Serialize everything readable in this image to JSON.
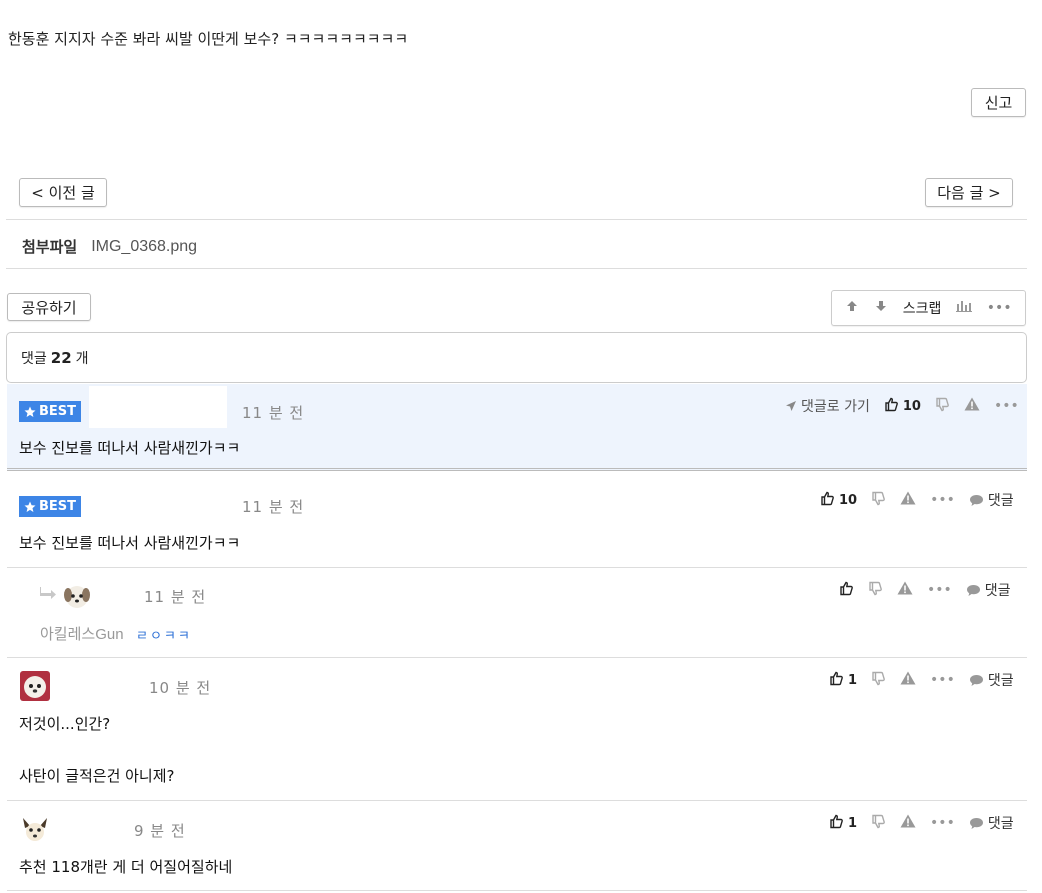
{
  "post": {
    "body": "한동훈 지지자 수준 봐라 씨발 이딴게 보수? ㅋㅋㅋㅋㅋㅋㅋㅋㅋ",
    "report_label": "신고",
    "prev_label": "< 이전 글",
    "next_label": "다음 글 >"
  },
  "attachment": {
    "label": "첨부파일",
    "filename": "IMG_0368.png"
  },
  "share_label": "공유하기",
  "toolbar": {
    "up_icon": "arrow-up-icon",
    "down_icon": "arrow-down-icon",
    "scrap_label": "스크랩",
    "stats_icon": "bar-chart-icon",
    "more_icon": "more-icon"
  },
  "comments_header": {
    "prefix": "댓글",
    "count": "22",
    "suffix": "개"
  },
  "best_pinned": {
    "badge": "BEST",
    "time": "11 분 전",
    "goto_label": "댓글로 가기",
    "likes": "10",
    "text": "보수 진보를 떠나서 사람새낀가ㅋㅋ"
  },
  "comments": [
    {
      "badge": "BEST",
      "time": "11 분 전",
      "likes": "10",
      "reply_label": "댓글",
      "text": "보수 진보를 떠나서 사람새낀가ㅋㅋ"
    },
    {
      "time": "11 분 전",
      "likes": "",
      "reply_label": "댓글",
      "reply_to": "아킬레스Gun",
      "text": "ㄹㅇㅋㅋ"
    },
    {
      "time": "10 분 전",
      "likes": "1",
      "reply_label": "댓글",
      "text_line1": "저것이...인간?",
      "text_line2": "사탄이 글적은건 아니제?"
    },
    {
      "time": "9 분 전",
      "likes": "1",
      "reply_label": "댓글",
      "text": "추천 118개란 게 더 어질어질하네"
    }
  ],
  "colors": {
    "best_badge": "#3d85e6",
    "best_bg": "#eef4fd",
    "reply_text": "#2b6fd6"
  }
}
